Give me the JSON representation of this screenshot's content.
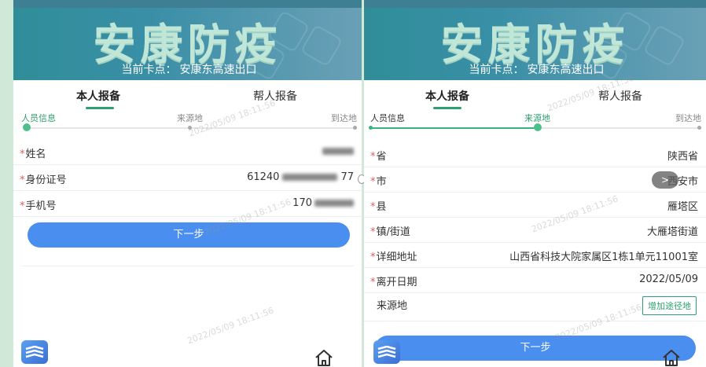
{
  "banner": {
    "title": "安康防疫",
    "checkpoint_label": "当前卡点：",
    "checkpoint_value": "安康东高速出口"
  },
  "tabs": [
    "本人报备",
    "帮人报备"
  ],
  "steps": [
    "人员信息",
    "来源地",
    "到达地"
  ],
  "left_form": {
    "name_label": "姓名",
    "id_label": "身份证号",
    "id_value": "61240",
    "id_tail": "77",
    "phone_label": "手机号",
    "phone_value": "170"
  },
  "right_form": {
    "province_label": "省",
    "province_value": "陕西省",
    "city_label": "市",
    "city_value": "西安市",
    "county_label": "县",
    "county_value": "雁塔区",
    "town_label": "镇/街道",
    "town_value": "大雁塔街道",
    "address_label": "详细地址",
    "address_value": "山西省科技大院家属区1栋1单元11001室",
    "leave_label": "离开日期",
    "leave_value": "2022/05/09",
    "source_label": "来源地",
    "add_route_label": "增加途径地"
  },
  "buttons": {
    "next_label": "下一步"
  },
  "fab_label": ">",
  "watermark": "2022/05/09 18:11:56",
  "colors": {
    "accent_green": "#2e9f6e",
    "button_blue": "#4a8ef0",
    "required_red": "#e35b5b"
  }
}
